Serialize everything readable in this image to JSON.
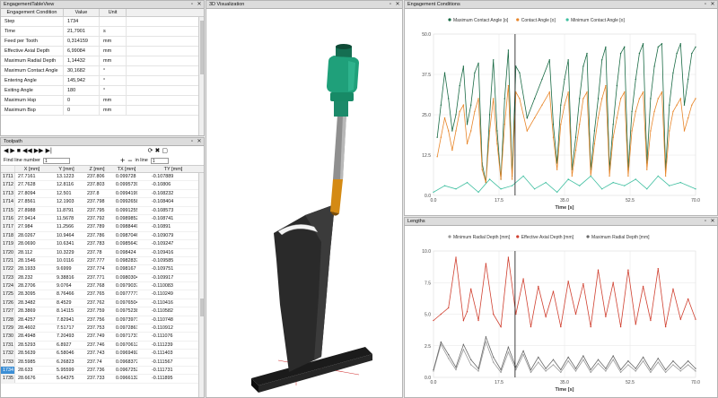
{
  "engagement_panel": {
    "title": "EngagementTableView",
    "headers": [
      "Engagement Condition",
      "Value",
      "Unit"
    ],
    "rows": [
      [
        "Step",
        "1734",
        ""
      ],
      [
        "Time",
        "21,7901",
        "s"
      ],
      [
        "Feed per Tooth",
        "0,314159",
        "mm"
      ],
      [
        "Effective Axial Depth",
        "6,99084",
        "mm"
      ],
      [
        "Maximum Radial Depth",
        "1,14432",
        "mm"
      ],
      [
        "Maximum Contact Angle",
        "30,1682",
        "°"
      ],
      [
        "Entering Angle",
        "145,942",
        "°"
      ],
      [
        "Exiting Angle",
        "180",
        "°"
      ],
      [
        "Maximum Hsp",
        "0",
        "mm"
      ],
      [
        "Maximum Bsp",
        "0",
        "mm"
      ]
    ]
  },
  "toolpath_panel": {
    "title": "Toolpath",
    "find_label": "Find line number",
    "find_value": "1",
    "in_line_label": "in line",
    "in_line_value": "1",
    "headers": [
      "",
      "X [mm]",
      "Y [mm]",
      "Z [mm]",
      "TX [mm]",
      "TY [mm]"
    ],
    "rows": [
      [
        "1711",
        "27.7161",
        "13.1223",
        "237.806",
        "0.099728",
        "-0.107889"
      ],
      [
        "1712",
        "27.7628",
        "12.8116",
        "237.803",
        "0.0995739",
        "-0.10806"
      ],
      [
        "1713",
        "27.8094",
        "12.501",
        "237.8",
        "0.0994199",
        "-0.108232"
      ],
      [
        "1714",
        "27.8561",
        "12.1903",
        "237.798",
        "0.0992658",
        "-0.108404"
      ],
      [
        "1715",
        "27.8988",
        "11.8791",
        "237.795",
        "0.0991255",
        "-0.108573"
      ],
      [
        "1716",
        "27.9414",
        "11.5678",
        "237.792",
        "0.0989852",
        "-0.108741"
      ],
      [
        "1717",
        "27.984",
        "11.2566",
        "237.789",
        "0.0988449",
        "-0.10891"
      ],
      [
        "1718",
        "28.0267",
        "10.9464",
        "237.786",
        "0.0987046",
        "-0.109079"
      ],
      [
        "1719",
        "28.0690",
        "10.6341",
        "237.783",
        "0.0985643",
        "-0.109247"
      ],
      [
        "1720",
        "28.112",
        "10.3229",
        "237.78",
        "0.098424",
        "-0.109416"
      ],
      [
        "1721",
        "28.1546",
        "10.0116",
        "237.777",
        "0.0982837",
        "-0.109585"
      ],
      [
        "1722",
        "28.1933",
        "9.6999",
        "237.774",
        "0.098167",
        "-0.109751"
      ],
      [
        "1723",
        "28.232",
        "9.38816",
        "237.771",
        "0.0980304",
        "-0.109917"
      ],
      [
        "1724",
        "28.2706",
        "9.0764",
        "237.768",
        "0.0979037",
        "-0.110083"
      ],
      [
        "1725",
        "28.3095",
        "8.76466",
        "237.765",
        "0.0977771",
        "-0.110249"
      ],
      [
        "1726",
        "28.3482",
        "8.4529",
        "237.762",
        "0.0976504",
        "-0.110416"
      ],
      [
        "1727",
        "28.3869",
        "8.14115",
        "237.759",
        "0.0975238",
        "-0.110582"
      ],
      [
        "1728",
        "28.4257",
        "7.82941",
        "237.756",
        "0.0973971",
        "-0.110748"
      ],
      [
        "1729",
        "28.4602",
        "7.51717",
        "237.753",
        "0.0972861",
        "-0.110912"
      ],
      [
        "1730",
        "28.4948",
        "7.20493",
        "237.749",
        "0.0971731",
        "-0.111076"
      ],
      [
        "1731",
        "28.5293",
        "6.8927",
        "237.746",
        "0.0970612",
        "-0.111239"
      ],
      [
        "1732",
        "28.5639",
        "6.58046",
        "237.743",
        "0.0969492",
        "-0.111403"
      ],
      [
        "1733",
        "28.5985",
        "6.26823",
        "237.74",
        "0.0968372",
        "-0.111567"
      ],
      [
        "1734",
        "28.633",
        "5.95599",
        "237.736",
        "0.0967252",
        "-0.111731"
      ],
      [
        "1735",
        "28.6676",
        "5.64375",
        "237.733",
        "0.0966132",
        "-0.111895"
      ]
    ],
    "selected_row": "1734"
  },
  "viz_panel": {
    "title": "3D Visualization"
  },
  "engagement_chart_panel": {
    "title": "Engagement Conditions"
  },
  "lengths_chart_panel": {
    "title": "Lengths"
  },
  "colors": {
    "max_contact": "#1a6b45",
    "contact": "#e8862a",
    "min_contact": "#3fbfa0",
    "min_radial": "#9a9a9a",
    "eff_axial": "#d04030",
    "max_radial": "#6a6a6a"
  },
  "chart_data": [
    {
      "type": "line",
      "title": "",
      "xlabel": "Time [s]",
      "ylabel": "",
      "xlim": [
        0,
        70
      ],
      "ylim": [
        0,
        50
      ],
      "xticks": [
        "0.0",
        "17.5",
        "35.0",
        "52.5",
        "70.0"
      ],
      "yticks": [
        "0.0",
        "12.5",
        "25.0",
        "37.5",
        "50.0"
      ],
      "legend": "top",
      "cursor_x": 21.79,
      "series": [
        {
          "name": "Maximum Contact Angle [o]",
          "color_key": "max_contact",
          "x": [
            1,
            2,
            3,
            4,
            5,
            6,
            7,
            8,
            9,
            10,
            11,
            12,
            13,
            14,
            15,
            16,
            17,
            18,
            19,
            20,
            21,
            22,
            23,
            25,
            27,
            29,
            31,
            32,
            33,
            34,
            35,
            36,
            37,
            38,
            39,
            40,
            41,
            42,
            43,
            44,
            45,
            46,
            47,
            48,
            49,
            50,
            51,
            52,
            53,
            54,
            55,
            56,
            57,
            58,
            59,
            60,
            61,
            62,
            63,
            64,
            65,
            66,
            67,
            68,
            69,
            70
          ],
          "y": [
            18,
            28,
            38,
            30,
            20,
            25,
            34,
            40,
            22,
            28,
            38,
            41,
            10,
            4,
            25,
            42,
            20,
            5,
            30,
            45,
            6,
            40,
            38,
            24,
            30,
            36,
            42,
            22,
            10,
            28,
            36,
            42,
            8,
            18,
            30,
            40,
            44,
            8,
            20,
            30,
            42,
            46,
            8,
            22,
            34,
            44,
            46,
            8,
            26,
            36,
            44,
            47,
            10,
            30,
            40,
            46,
            47,
            8,
            28,
            38,
            44,
            47,
            28,
            36,
            44,
            46
          ]
        },
        {
          "name": "Contact Angle [o]",
          "color_key": "contact",
          "x": [
            1,
            2,
            3,
            4,
            5,
            6,
            7,
            8,
            9,
            10,
            11,
            12,
            13,
            14,
            15,
            16,
            17,
            18,
            19,
            20,
            21,
            22,
            23,
            25,
            27,
            29,
            31,
            32,
            33,
            34,
            35,
            36,
            37,
            38,
            39,
            40,
            41,
            42,
            43,
            44,
            45,
            46,
            47,
            48,
            49,
            50,
            51,
            52,
            53,
            54,
            55,
            56,
            57,
            58,
            59,
            60,
            61,
            62,
            63,
            64,
            65,
            66,
            67,
            68,
            69,
            70
          ],
          "y": [
            12,
            18,
            24,
            20,
            14,
            20,
            26,
            28,
            16,
            20,
            26,
            30,
            8,
            4,
            20,
            30,
            16,
            5,
            22,
            34,
            5,
            32,
            30,
            20,
            24,
            28,
            32,
            18,
            8,
            22,
            28,
            32,
            6,
            14,
            22,
            30,
            32,
            6,
            16,
            24,
            30,
            34,
            6,
            18,
            24,
            30,
            32,
            6,
            20,
            26,
            30,
            32,
            8,
            20,
            26,
            30,
            32,
            6,
            20,
            26,
            28,
            30,
            20,
            24,
            28,
            30
          ]
        },
        {
          "name": "Minimum Contact Angle [o]",
          "color_key": "min_contact",
          "x": [
            0,
            3,
            6,
            9,
            12,
            15,
            18,
            21,
            24,
            27,
            30,
            33,
            36,
            39,
            42,
            45,
            48,
            51,
            54,
            57,
            60,
            63,
            66,
            70
          ],
          "y": [
            1,
            3,
            2,
            4,
            1,
            5,
            2,
            3,
            6,
            2,
            4,
            1,
            5,
            3,
            6,
            2,
            4,
            3,
            5,
            2,
            6,
            3,
            4,
            2
          ]
        }
      ]
    },
    {
      "type": "line",
      "title": "",
      "xlabel": "Time [s]",
      "ylabel": "",
      "xlim": [
        0,
        70
      ],
      "ylim": [
        0,
        10
      ],
      "xticks": [
        "0.0",
        "17.5",
        "35.0",
        "52.5",
        "70.0"
      ],
      "yticks": [
        "0.0",
        "2.5",
        "5.0",
        "7.5",
        "10.0"
      ],
      "legend": "top",
      "cursor_x": 21.79,
      "series": [
        {
          "name": "Minimum Radial Depth [mm]",
          "color_key": "min_radial",
          "x": [
            0,
            2,
            4,
            6,
            8,
            10,
            12,
            14,
            16,
            18,
            20,
            22,
            24,
            26,
            28,
            30,
            32,
            34,
            36,
            38,
            40,
            42,
            44,
            46,
            48,
            50,
            52,
            54,
            56,
            58,
            60,
            62,
            64,
            66,
            68,
            70
          ],
          "y": [
            0.5,
            2.6,
            1.5,
            0.6,
            2.2,
            1.0,
            0.5,
            2.8,
            1.2,
            0.4,
            2.0,
            0.6,
            1.8,
            0.4,
            1.2,
            0.5,
            1.0,
            0.4,
            1.3,
            0.5,
            1.4,
            0.4,
            1.1,
            0.5,
            1.4,
            0.4,
            1.0,
            0.5,
            1.3,
            0.4,
            1.2,
            0.4,
            1.0,
            0.5,
            1.0,
            0.5
          ]
        },
        {
          "name": "Effective Axial Depth [mm]",
          "color_key": "eff_axial",
          "x": [
            0,
            2,
            4,
            6,
            8,
            9,
            10,
            12,
            14,
            16,
            18,
            20,
            22,
            24,
            26,
            28,
            30,
            32,
            34,
            36,
            38,
            40,
            42,
            44,
            46,
            48,
            50,
            52,
            54,
            56,
            58,
            60,
            62,
            64,
            66,
            68,
            70
          ],
          "y": [
            4.5,
            5.0,
            5.5,
            9.5,
            4.5,
            5.2,
            7.0,
            4.5,
            9.0,
            5.0,
            4.0,
            9.5,
            5.0,
            7.8,
            4.0,
            7.2,
            4.8,
            6.8,
            4.0,
            7.6,
            5.0,
            7.4,
            4.0,
            8.5,
            4.8,
            7.5,
            4.0,
            8.5,
            4.2,
            7.2,
            4.5,
            8.6,
            4.0,
            7.0,
            4.6,
            6.2,
            4.6
          ]
        },
        {
          "name": "Maximum Radial Depth [mm]",
          "color_key": "max_radial",
          "x": [
            0,
            2,
            4,
            6,
            8,
            10,
            12,
            14,
            16,
            18,
            20,
            22,
            24,
            26,
            28,
            30,
            32,
            34,
            36,
            38,
            40,
            42,
            44,
            46,
            48,
            50,
            52,
            54,
            56,
            58,
            60,
            62,
            64,
            66,
            68,
            70
          ],
          "y": [
            0.6,
            2.8,
            1.8,
            0.8,
            2.6,
            1.4,
            0.7,
            3.2,
            1.6,
            0.6,
            2.4,
            0.8,
            2.1,
            0.6,
            1.6,
            0.7,
            1.4,
            0.6,
            1.6,
            0.7,
            1.7,
            0.6,
            1.4,
            0.7,
            1.7,
            0.6,
            1.3,
            0.7,
            1.6,
            0.6,
            1.5,
            0.6,
            1.3,
            0.7,
            1.3,
            0.7
          ]
        }
      ]
    }
  ]
}
